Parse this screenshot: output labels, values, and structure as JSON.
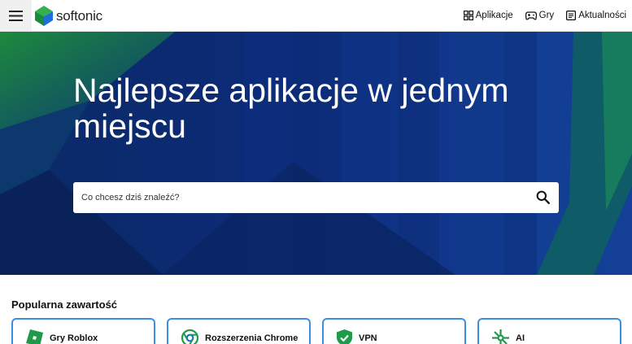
{
  "header": {
    "logo_text": "softonic",
    "nav": [
      {
        "label": "Aplikacje",
        "icon": "apps-grid-icon"
      },
      {
        "label": "Gry",
        "icon": "gamepad-icon"
      },
      {
        "label": "Aktualności",
        "icon": "news-icon"
      }
    ]
  },
  "hero": {
    "title": "Najlepsze aplikacje w jednym miejscu",
    "search_placeholder": "Co chcesz dziś znaleźć?"
  },
  "popular": {
    "title": "Popularna zawartość",
    "cards": [
      {
        "label": "Gry Roblox",
        "icon": "roblox-icon"
      },
      {
        "label": "Rozszerzenia Chrome",
        "icon": "chrome-icon"
      },
      {
        "label": "VPN",
        "icon": "shield-check-icon"
      },
      {
        "label": "AI",
        "icon": "ai-icon"
      }
    ]
  },
  "colors": {
    "accent_border": "#3b8ee0",
    "hero_dark": "#0a1f5c",
    "brand_green": "#2aa24a",
    "brand_blue": "#1d6fd8"
  }
}
